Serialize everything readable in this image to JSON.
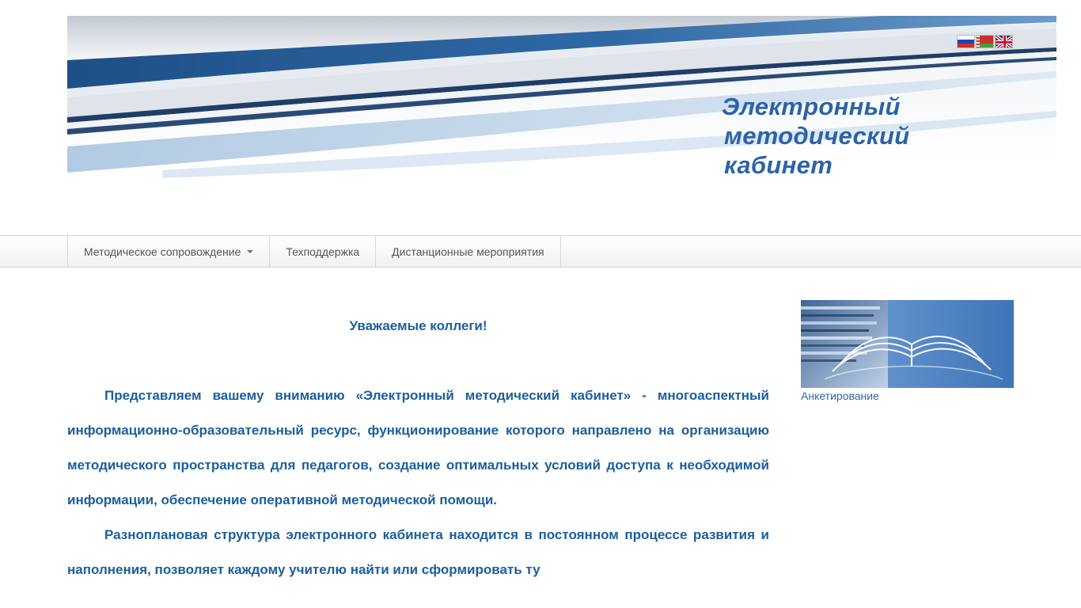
{
  "header": {
    "title_lines": [
      "Электронный",
      "методический",
      "кабинет"
    ],
    "languages": [
      {
        "code": "ru",
        "icon": "flag-russia-icon"
      },
      {
        "code": "by",
        "icon": "flag-belarus-icon"
      },
      {
        "code": "en",
        "icon": "flag-uk-icon"
      }
    ]
  },
  "nav": {
    "items": [
      {
        "label": "Методическое сопровождение",
        "has_dropdown": true
      },
      {
        "label": "Техподдержка",
        "has_dropdown": false
      },
      {
        "label": "Дистанционные мероприятия",
        "has_dropdown": false
      }
    ]
  },
  "main": {
    "greeting": "Уважаемые коллеги!",
    "paragraphs": [
      "Представляем вашему вниманию «Электронный методический кабинет» - многоаспектный информационно-образовательный ресурс, функционирование которого направлено на организацию методического пространства для педагогов, создание оптимальных условий доступа к необходимой информации, обеспечение оперативной методической помощи.",
      "Разноплановая структура электронного кабинета находится в постоянном процессе развития и наполнения, позволяет каждому учителю найти или сформировать ту"
    ]
  },
  "sidebar": {
    "link_label": "Анкетирование"
  },
  "colors": {
    "title_blue": "#2b63a8",
    "text_blue": "#1a5f9e",
    "link_blue": "#2a6aa8",
    "banner_dark_blue": "#1e4f86"
  }
}
